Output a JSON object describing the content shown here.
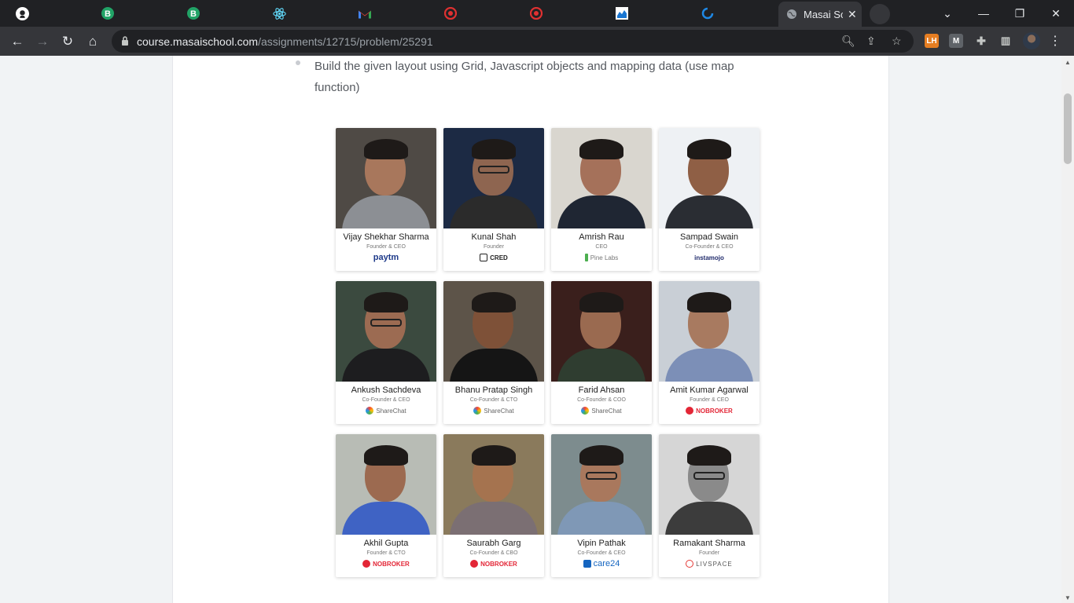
{
  "browser": {
    "tab_icons": [
      "github-icon",
      "bootstrap-icon",
      "bootstrap-icon",
      "react-icon",
      "gmail-icon",
      "target-icon",
      "target-icon",
      "reports-icon",
      "refresh-ring-icon"
    ],
    "active_tab_title": "Masai Sc",
    "url_host": "course.masaischool.com",
    "url_path": "/assignments/12715/problem/25291",
    "extensions": [
      "LH",
      "M"
    ]
  },
  "page": {
    "instruction": "Build the given layout using Grid, Javascript objects and mapping data (use map function)"
  },
  "cards": [
    {
      "name": "Vijay Shekhar Sharma",
      "role": "Founder & CEO",
      "company": "paytm",
      "logo_color": "#1e3a8a",
      "photo_bg": "#4f4a45",
      "shirt": "#8c8f94",
      "skin": "#a8775c"
    },
    {
      "name": "Kunal Shah",
      "role": "Founder",
      "company": "CRED",
      "logo_color": "#222222",
      "photo_bg": "#1c2a44",
      "shirt": "#2b2b2b",
      "skin": "#8e6550"
    },
    {
      "name": "Amrish Rau",
      "role": "CEO",
      "company": "Pine Labs",
      "logo_color": "#4caf50",
      "photo_bg": "#d9d6cf",
      "shirt": "#1f2633",
      "skin": "#a5715a"
    },
    {
      "name": "Sampad Swain",
      "role": "Co-Founder & CEO",
      "company": "instamojo",
      "logo_color": "#1f2a6b",
      "photo_bg": "#eef1f4",
      "shirt": "#2a2d33",
      "skin": "#8f5f45"
    },
    {
      "name": "Ankush Sachdeva",
      "role": "Co-Founder & CEO",
      "company": "ShareChat",
      "logo_color": "#f4a300",
      "photo_bg": "#3b4a3f",
      "shirt": "#1d1d1f",
      "skin": "#9c6b52"
    },
    {
      "name": "Bhanu Pratap Singh",
      "role": "Co-Founder & CTO",
      "company": "ShareChat",
      "logo_color": "#f4a300",
      "photo_bg": "#5d5449",
      "shirt": "#151515",
      "skin": "#7e5138"
    },
    {
      "name": "Farid Ahsan",
      "role": "Co-Founder & COO",
      "company": "ShareChat",
      "logo_color": "#f4a300",
      "photo_bg": "#3a1f1c",
      "shirt": "#2f3d30",
      "skin": "#9a6a50"
    },
    {
      "name": "Amit Kumar Agarwal",
      "role": "Founder & CEO",
      "company": "NOBROKER",
      "logo_color": "#e32636",
      "photo_bg": "#c9cfd6",
      "shirt": "#7c8fb7",
      "skin": "#a87a60"
    },
    {
      "name": "Akhil Gupta",
      "role": "Founder & CTO",
      "company": "NOBROKER",
      "logo_color": "#e32636",
      "photo_bg": "#b8bcb5",
      "shirt": "#3f63c4",
      "skin": "#9c6a50"
    },
    {
      "name": "Saurabh Garg",
      "role": "Co-Founder & CBO",
      "company": "NOBROKER",
      "logo_color": "#e32636",
      "photo_bg": "#8a7a5c",
      "shirt": "#7b6f73",
      "skin": "#a5734f"
    },
    {
      "name": "Vipin Pathak",
      "role": "Co-Founder & CEO",
      "company": "care24",
      "logo_color": "#1565c0",
      "photo_bg": "#7d8c8e",
      "shirt": "#7f98b6",
      "skin": "#a9785d"
    },
    {
      "name": "Ramakant Sharma",
      "role": "Founder",
      "company": "LIVSPACE",
      "logo_color": "#e53935",
      "photo_bg": "#d6d6d6",
      "shirt": "#3c3c3c",
      "skin": "#8a8a8a"
    }
  ]
}
